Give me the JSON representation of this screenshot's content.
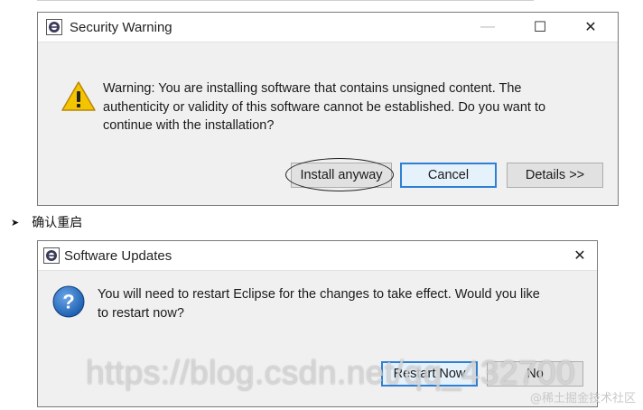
{
  "security_dialog": {
    "title": "Security Warning",
    "minimize_glyph": "—",
    "maximize_glyph": "☐",
    "close_glyph": "✕",
    "message_line1": "Warning: You are installing software that contains unsigned content. The",
    "message_line2": "authenticity or validity of this software cannot be established. Do you want to",
    "message_line3": "continue with the installation?",
    "buttons": {
      "install": "Install anyway",
      "cancel": "Cancel",
      "details": "Details >>"
    },
    "icons": {
      "app": "eclipse-icon",
      "message": "warning-icon"
    }
  },
  "caption": {
    "bullet": "➤",
    "text": "确认重启"
  },
  "updates_dialog": {
    "title": "Software Updates",
    "close_glyph": "✕",
    "message_line1": "You will need to restart Eclipse for the changes to take effect. Would you like",
    "message_line2": "to restart now?",
    "buttons": {
      "restart": "Restart Now",
      "no": "No"
    },
    "icons": {
      "app": "eclipse-icon",
      "message": "question-icon"
    }
  },
  "watermark": {
    "url": "https://blog.csdn.net/qq_432700",
    "site": "@稀土掘金技术社区"
  },
  "colors": {
    "focus_border": "#2f7fd5",
    "dialog_bg": "#f0f0f0",
    "titlebar_bg": "#ffffff",
    "warning_yellow": "#f5c400",
    "question_blue": "#1d5fb0"
  }
}
